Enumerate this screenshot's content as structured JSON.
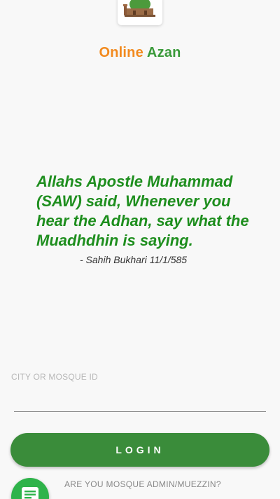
{
  "app": {
    "title_part1": "Online",
    "title_part2": "Azan",
    "colors": {
      "title_orange": "#f28a1e",
      "title_green": "#3a9a3a",
      "quote_green": "#1e8e1e",
      "button_green": "#3a8c3a",
      "fab_green": "#2eb34a"
    }
  },
  "logo": {
    "icon": "mosque-logo-icon"
  },
  "quote": {
    "text": "Allahs Apostle Muhammad (SAW) said, Whenever you hear the Adhan, say what the Muadhdhin is saying.",
    "source": "- Sahih Bukhari 11/1/585"
  },
  "form": {
    "city_label": "CITY OR MOSQUE ID",
    "city_value": "",
    "login_label": "LOGIN"
  },
  "footer": {
    "admin_link": "ARE YOU MOSQUE ADMIN/MUEZZIN?",
    "fab_icon": "message-icon"
  }
}
